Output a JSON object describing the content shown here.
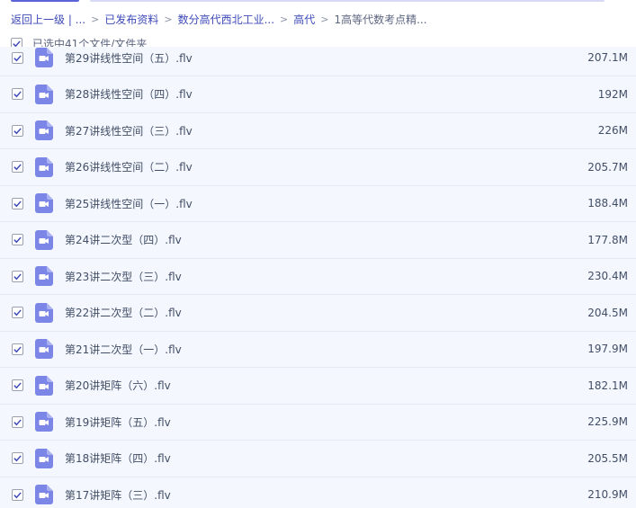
{
  "breadcrumb": {
    "items": [
      "返回上一级 | ...",
      "已发布资料",
      "数分高代西北工业...",
      "高代",
      "1高等代数考点精..."
    ],
    "separator": ">"
  },
  "selection": {
    "label": "已选中41个文件/文件夹"
  },
  "files": [
    {
      "name": "第29讲线性空间（五）.flv",
      "size": "207.1M"
    },
    {
      "name": "第28讲线性空间（四）.flv",
      "size": "192M"
    },
    {
      "name": "第27讲线性空间（三）.flv",
      "size": "226M"
    },
    {
      "name": "第26讲线性空间（二）.flv",
      "size": "205.7M"
    },
    {
      "name": "第25讲线性空间（一）.flv",
      "size": "188.4M"
    },
    {
      "name": "第24讲二次型（四）.flv",
      "size": "177.8M"
    },
    {
      "name": "第23讲二次型（三）.flv",
      "size": "230.4M"
    },
    {
      "name": "第22讲二次型（二）.flv",
      "size": "204.5M"
    },
    {
      "name": "第21讲二次型（一）.flv",
      "size": "197.9M"
    },
    {
      "name": "第20讲矩阵（六）.flv",
      "size": "182.1M"
    },
    {
      "name": "第19讲矩阵（五）.flv",
      "size": "225.9M"
    },
    {
      "name": "第18讲矩阵（四）.flv",
      "size": "205.5M"
    },
    {
      "name": "第17讲矩阵（三）.flv",
      "size": "210.9M"
    }
  ],
  "colors": {
    "accent": "#5c63d8",
    "link": "#3e4ab8",
    "row_background": "#f4f8fe",
    "video_icon": "#7b86e6"
  },
  "icons": {
    "checkbox": "checkmark-icon",
    "file": "video-file-icon"
  }
}
